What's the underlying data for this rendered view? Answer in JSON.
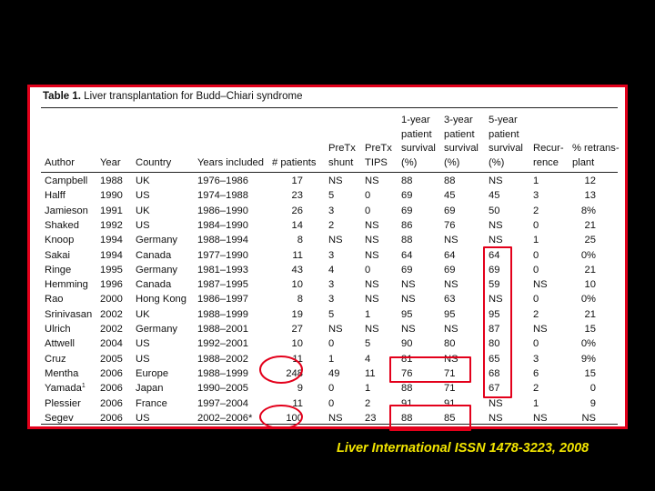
{
  "table": {
    "title_label": "Table 1.",
    "title_text": "Liver transplantation for Budd–Chiari syndrome",
    "headers": [
      [
        "Author"
      ],
      [
        "Year"
      ],
      [
        "Country"
      ],
      [
        "Years included"
      ],
      [
        "# patients"
      ],
      [
        "PreTx",
        "shunt"
      ],
      [
        "PreTx",
        "TIPS"
      ],
      [
        "1-year",
        "patient",
        "survival",
        "(%)"
      ],
      [
        "3-year",
        "patient",
        "survival",
        "(%)"
      ],
      [
        "5-year",
        "patient",
        "survival",
        "(%)"
      ],
      [
        "Recur-",
        "rence"
      ],
      [
        "% retrans-",
        "plant"
      ]
    ],
    "rows": [
      [
        "Campbell",
        "1988",
        "UK",
        "1976–1986",
        "17",
        "NS",
        "NS",
        "88",
        "88",
        "NS",
        "1",
        "12"
      ],
      [
        "Halff",
        "1990",
        "US",
        "1974–1988",
        "23",
        "5",
        "0",
        "69",
        "45",
        "45",
        "3",
        "13"
      ],
      [
        "Jamieson",
        "1991",
        "UK",
        "1986–1990",
        "26",
        "3",
        "0",
        "69",
        "69",
        "50",
        "2",
        "8%"
      ],
      [
        "Shaked",
        "1992",
        "US",
        "1984–1990",
        "14",
        "2",
        "NS",
        "86",
        "76",
        "NS",
        "0",
        "21"
      ],
      [
        "Knoop",
        "1994",
        "Germany",
        "1988–1994",
        "8",
        "NS",
        "NS",
        "88",
        "NS",
        "NS",
        "1",
        "25"
      ],
      [
        "Sakai",
        "1994",
        "Canada",
        "1977–1990",
        "11",
        "3",
        "NS",
        "64",
        "64",
        "64",
        "0",
        "0%"
      ],
      [
        "Ringe",
        "1995",
        "Germany",
        "1981–1993",
        "43",
        "4",
        "0",
        "69",
        "69",
        "69",
        "0",
        "21"
      ],
      [
        "Hemming",
        "1996",
        "Canada",
        "1987–1995",
        "10",
        "3",
        "NS",
        "NS",
        "NS",
        "59",
        "NS",
        "10"
      ],
      [
        "Rao",
        "2000",
        "Hong Kong",
        "1986–1997",
        "8",
        "3",
        "NS",
        "NS",
        "63",
        "NS",
        "0",
        "0%"
      ],
      [
        "Srinivasan",
        "2002",
        "UK",
        "1988–1999",
        "19",
        "5",
        "1",
        "95",
        "95",
        "95",
        "2",
        "21"
      ],
      [
        "Ulrich",
        "2002",
        "Germany",
        "1988–2001",
        "27",
        "NS",
        "NS",
        "NS",
        "NS",
        "87",
        "NS",
        "15"
      ],
      [
        "Attwell",
        "2004",
        "US",
        "1992–2001",
        "10",
        "0",
        "5",
        "90",
        "80",
        "80",
        "0",
        "0%"
      ],
      [
        "Cruz",
        "2005",
        "US",
        "1988–2002",
        "11",
        "1",
        "4",
        "81",
        "NS",
        "65",
        "3",
        "9%"
      ],
      [
        "Mentha",
        "2006",
        "Europe",
        "1988–1999",
        "248",
        "49",
        "11",
        "76",
        "71",
        "68",
        "6",
        "15"
      ],
      [
        "Yamada",
        "2006",
        "Japan",
        "1990–2005",
        "9",
        "0",
        "1",
        "88",
        "71",
        "67",
        "2",
        "0"
      ],
      [
        "Plessier",
        "2006",
        "France",
        "1997–2004",
        "11",
        "0",
        "2",
        "91",
        "91",
        "NS",
        "1",
        "9"
      ],
      [
        "Segev",
        "2006",
        "US",
        "2002–2006*",
        "100",
        "NS",
        "23",
        "88",
        "85",
        "NS",
        "NS",
        "NS"
      ]
    ],
    "superscripts": {
      "Yamada": "1"
    }
  },
  "citation": "Liver International ISSN 1478-3223, 2008",
  "colors": {
    "background": "#000000",
    "highlight": "#e3001b",
    "citation": "#f2e500",
    "paper": "#ffffff"
  }
}
